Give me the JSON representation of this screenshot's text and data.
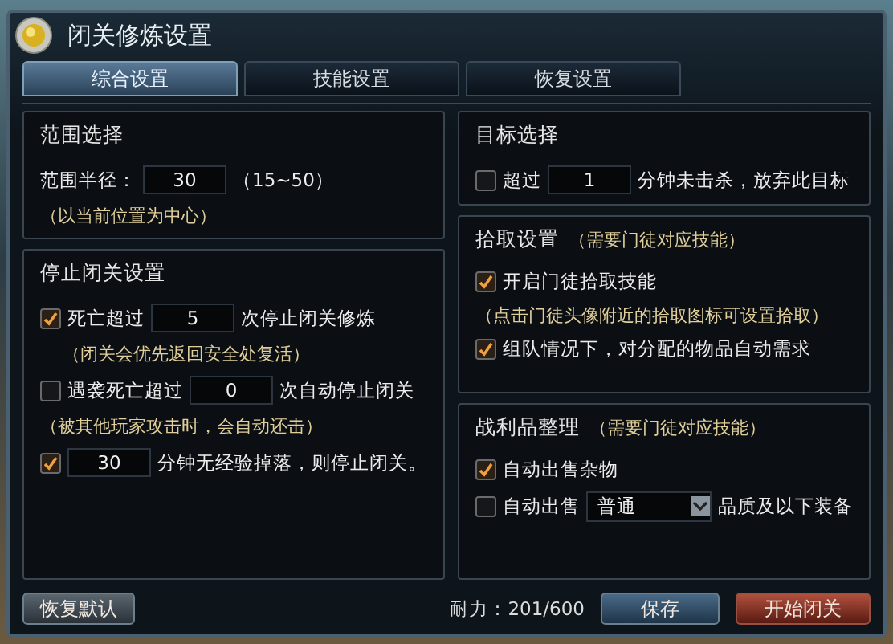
{
  "window": {
    "title": "闭关修炼设置"
  },
  "tabs": [
    {
      "label": "综合设置",
      "selected": true
    },
    {
      "label": "技能设置",
      "selected": false
    },
    {
      "label": "恢复设置",
      "selected": false
    }
  ],
  "left_panels": [
    {
      "title": "范围选择",
      "rows": [
        {
          "kind": "plain",
          "segments": [
            {
              "kind": "text",
              "text": "范围半径："
            },
            {
              "kind": "input",
              "value": "30"
            },
            {
              "kind": "text",
              "text": "（15~50）"
            }
          ]
        },
        {
          "kind": "note",
          "text": "（以当前位置为中心）"
        }
      ]
    },
    {
      "title": "停止闭关设置",
      "rows": [
        {
          "kind": "check",
          "checked": true,
          "segments": [
            {
              "kind": "text",
              "text": "死亡超过"
            },
            {
              "kind": "input",
              "value": "5"
            },
            {
              "kind": "text",
              "text": "次停止闭关修炼"
            }
          ]
        },
        {
          "kind": "hint",
          "text": "（闭关会优先返回安全处复活）"
        },
        {
          "kind": "check",
          "checked": false,
          "segments": [
            {
              "kind": "text",
              "text": "遇袭死亡超过"
            },
            {
              "kind": "input",
              "value": "0"
            },
            {
              "kind": "text",
              "text": "次自动停止闭关"
            }
          ]
        },
        {
          "kind": "note",
          "text": "（被其他玩家攻击时，会自动还击）"
        },
        {
          "kind": "check",
          "checked": true,
          "segments": [
            {
              "kind": "input",
              "value": "30"
            },
            {
              "kind": "text",
              "text": "分钟无经验掉落，则停止闭关。"
            }
          ]
        }
      ]
    }
  ],
  "right_panels": [
    {
      "title": "目标选择",
      "rows": [
        {
          "kind": "check",
          "checked": false,
          "segments": [
            {
              "kind": "text",
              "text": "超过"
            },
            {
              "kind": "input",
              "value": "1"
            },
            {
              "kind": "text",
              "text": "分钟未击杀，放弃此目标"
            }
          ]
        }
      ]
    },
    {
      "title": "拾取设置",
      "subtitle": "（需要门徒对应技能）",
      "rows": [
        {
          "kind": "check",
          "checked": true,
          "segments": [
            {
              "kind": "text",
              "text": "开启门徒拾取技能"
            }
          ]
        },
        {
          "kind": "note",
          "text": "（点击门徒头像附近的拾取图标可设置拾取）"
        },
        {
          "kind": "check",
          "checked": true,
          "segments": [
            {
              "kind": "text",
              "text": "组队情况下，对分配的物品自动需求"
            }
          ]
        }
      ]
    },
    {
      "title": "战利品整理",
      "subtitle": "（需要门徒对应技能）",
      "rows": [
        {
          "kind": "check",
          "checked": true,
          "segments": [
            {
              "kind": "text",
              "text": "自动出售杂物"
            }
          ]
        },
        {
          "kind": "check",
          "checked": false,
          "segments": [
            {
              "kind": "text",
              "text": "自动出售"
            },
            {
              "kind": "select",
              "value": "普通"
            },
            {
              "kind": "text",
              "text": "品质及以下装备"
            }
          ]
        }
      ]
    }
  ],
  "footer": {
    "reset_button": "恢复默认",
    "durability": "耐力：201/600",
    "save_button": "保存",
    "start_button": "开始闭关"
  }
}
